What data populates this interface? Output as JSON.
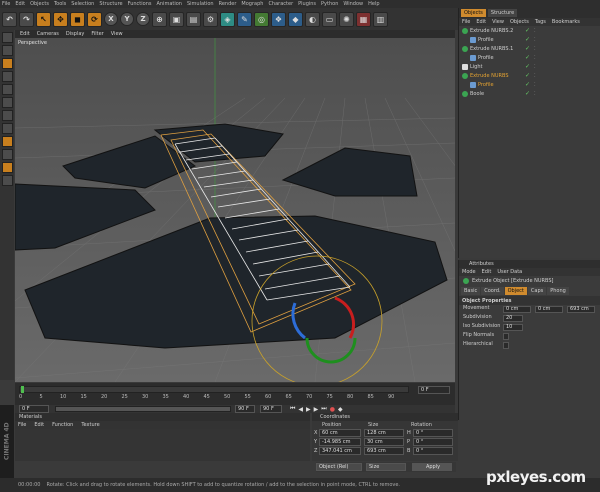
{
  "app": {
    "menu": [
      "File",
      "Edit",
      "Objects",
      "Tools",
      "Selection",
      "Structure",
      "Functions",
      "Animation",
      "Simulation",
      "Render",
      "Mograph",
      "Character",
      "Plugins",
      "Python",
      "Window",
      "Help"
    ]
  },
  "toolbar": {
    "axes": [
      "X",
      "Y",
      "Z"
    ]
  },
  "viewport": {
    "menu": [
      "Edit",
      "Cameras",
      "Display",
      "Filter",
      "View"
    ],
    "label": "Perspective"
  },
  "timeline": {
    "ticks": [
      "0",
      "5",
      "10",
      "15",
      "20",
      "25",
      "30",
      "35",
      "40",
      "45",
      "50",
      "55",
      "60",
      "65",
      "70",
      "75",
      "80",
      "85",
      "90"
    ],
    "end_frame": "0 F",
    "start_field": "0 F",
    "end_field": "90 F",
    "fps_field": "90 F"
  },
  "objects": {
    "tabs": [
      "Objects",
      "Structure"
    ],
    "menu": [
      "File",
      "Edit",
      "View",
      "Objects",
      "Tags",
      "Bookmarks"
    ],
    "items": [
      {
        "label": "Extrude NURBS.2",
        "indent": 0,
        "icon": "green"
      },
      {
        "label": "Profile",
        "indent": 1,
        "icon": "blue"
      },
      {
        "label": "Extrude NURBS.1",
        "indent": 0,
        "icon": "green"
      },
      {
        "label": "Profile",
        "indent": 1,
        "icon": "blue"
      },
      {
        "label": "Light",
        "indent": 0,
        "icon": "white"
      },
      {
        "label": "Extrude NURBS",
        "indent": 0,
        "icon": "green",
        "selected": true
      },
      {
        "label": "Profile",
        "indent": 1,
        "icon": "blue",
        "selected": true
      },
      {
        "label": "Boole",
        "indent": 0,
        "icon": "green"
      }
    ]
  },
  "attributes": {
    "title": "Attributes",
    "menu": [
      "Mode",
      "Edit",
      "User Data"
    ],
    "object_label": "Extrude Object [Extrude NURBS]",
    "tabs": [
      "Basic",
      "Coord.",
      "Object",
      "Caps",
      "Phong"
    ],
    "active_tab": "Object",
    "section": "Object Properties",
    "fields": [
      {
        "label": "Movement",
        "values": [
          "0 cm",
          "0 cm",
          "693 cm"
        ]
      },
      {
        "label": "Subdivision",
        "values": [
          "20"
        ]
      },
      {
        "label": "Iso Subdivision",
        "values": [
          "10"
        ]
      },
      {
        "label": "Flip Normals",
        "values": []
      },
      {
        "label": "Hierarchical",
        "values": []
      }
    ]
  },
  "materials": {
    "title": "Materials",
    "menu": [
      "File",
      "Edit",
      "Function",
      "Texture"
    ]
  },
  "coordinates": {
    "title": "Coordinates",
    "headers": [
      "Position",
      "Size",
      "Rotation"
    ],
    "rows": [
      {
        "axis": "X",
        "pos": "60 cm",
        "size": "128 cm",
        "rot_label": "H",
        "rot": "0 °"
      },
      {
        "axis": "Y",
        "pos": "-14.985 cm",
        "size": "30 cm",
        "rot_label": "P",
        "rot": "0 °"
      },
      {
        "axis": "Z",
        "pos": "347.041 cm",
        "size": "693 cm",
        "rot_label": "B",
        "rot": "0 °"
      }
    ],
    "mode_select": "Object (Rel)",
    "size_select": "Size",
    "apply": "Apply"
  },
  "statusbar": {
    "time": "00:00:00",
    "text": "Rotate: Click and drag to rotate elements. Hold down SHIFT to add to quantize rotation / add to the selection in point mode, CTRL to remove."
  },
  "brand": {
    "vertical": "CINEMA 4D"
  },
  "watermark": "pxleyes.com"
}
